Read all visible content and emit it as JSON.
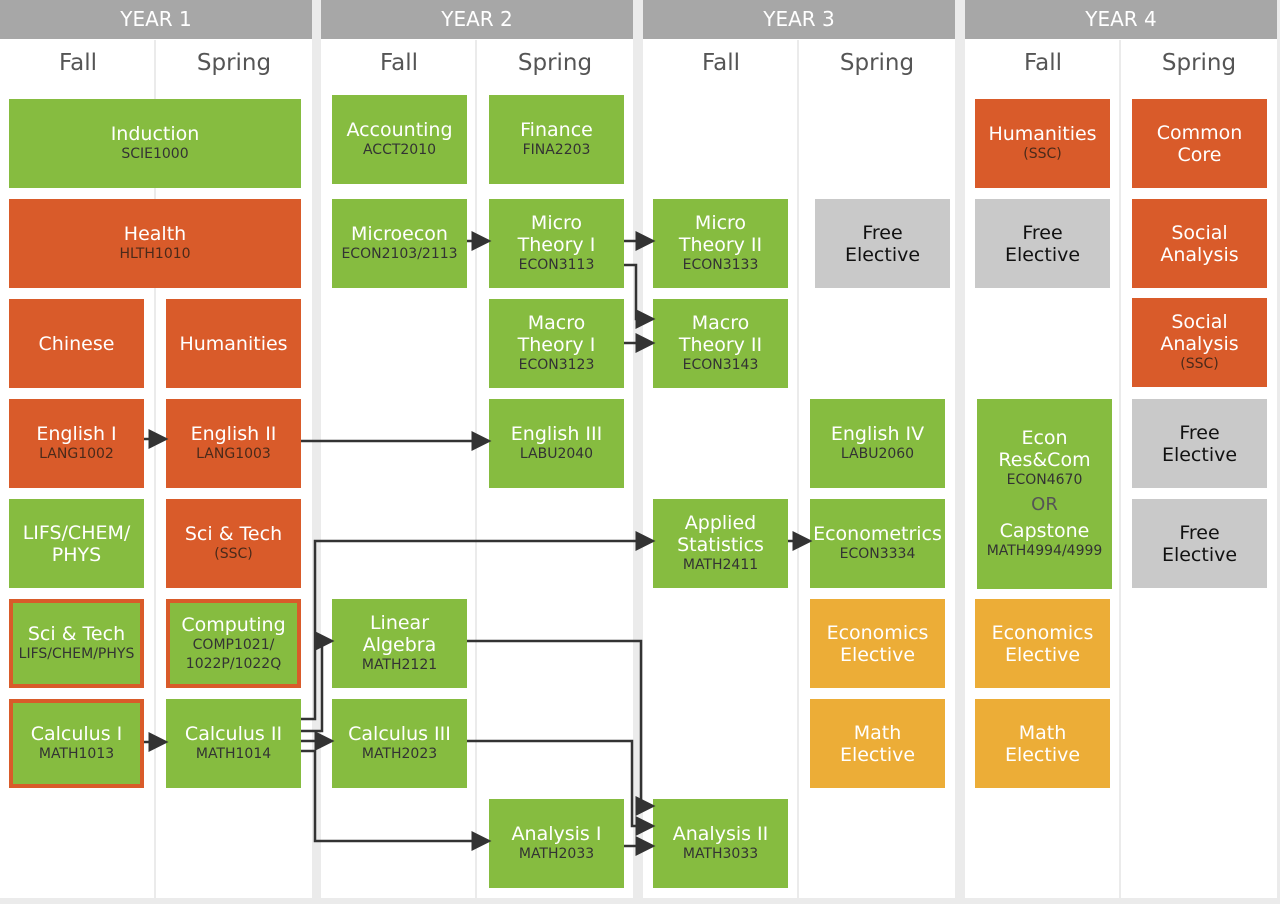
{
  "colors": {
    "green": "#86bc40",
    "orange": "#d95b2a",
    "gray": "#c9c9c9",
    "yellow": "#ecad37",
    "header": "#a7a7a7",
    "arrow": "#333333"
  },
  "years": [
    {
      "label": "YEAR 1",
      "fall": "Fall",
      "spring": "Spring"
    },
    {
      "label": "YEAR 2",
      "fall": "Fall",
      "spring": "Spring"
    },
    {
      "label": "YEAR 3",
      "fall": "Fall",
      "spring": "Spring"
    },
    {
      "label": "YEAR 4",
      "fall": "Fall",
      "spring": "Spring"
    }
  ],
  "boxes": [
    {
      "title": "Induction",
      "code": "SCIE1000",
      "color": "green"
    },
    {
      "title": "Health",
      "code": "HLTH1010",
      "color": "orange"
    },
    {
      "title": "Chinese",
      "code": "",
      "color": "orange"
    },
    {
      "title": "Humanities",
      "code": "",
      "color": "orange"
    },
    {
      "title": "English I",
      "code": "LANG1002",
      "color": "orange"
    },
    {
      "title": "English II",
      "code": "LANG1003",
      "color": "orange"
    },
    {
      "title": "LIFS/CHEM/\nPHYS",
      "code": "",
      "color": "green"
    },
    {
      "title": "Sci & Tech",
      "code": "(SSC)",
      "color": "orange"
    },
    {
      "title": "Sci & Tech",
      "code": "LIFS/CHEM/PHYS",
      "color": "green",
      "bordered": true
    },
    {
      "title": "Computing",
      "code": "COMP1021/\n1022P/1022Q",
      "color": "green",
      "bordered": true
    },
    {
      "title": "Calculus I",
      "code": "MATH1013",
      "color": "green",
      "bordered": true
    },
    {
      "title": "Calculus II",
      "code": "MATH1014",
      "color": "green"
    },
    {
      "title": "Accounting",
      "code": "ACCT2010",
      "color": "green"
    },
    {
      "title": "Finance",
      "code": "FINA2203",
      "color": "green"
    },
    {
      "title": "Microecon",
      "code": "ECON2103/2113",
      "color": "green"
    },
    {
      "title": "Micro\nTheory I",
      "code": "ECON3113",
      "color": "green"
    },
    {
      "title": "Macro\nTheory I",
      "code": "ECON3123",
      "color": "green"
    },
    {
      "title": "English III",
      "code": "LABU2040",
      "color": "green"
    },
    {
      "title": "Linear\nAlgebra",
      "code": "MATH2121",
      "color": "green"
    },
    {
      "title": "Calculus III",
      "code": "MATH2023",
      "color": "green"
    },
    {
      "title": "Analysis I",
      "code": "MATH2033",
      "color": "green"
    },
    {
      "title": "Micro\nTheory II",
      "code": "ECON3133",
      "color": "green"
    },
    {
      "title": "Free\nElective",
      "code": "",
      "color": "gray"
    },
    {
      "title": "Macro\nTheory II",
      "code": "ECON3143",
      "color": "green"
    },
    {
      "title": "English IV",
      "code": "LABU2060",
      "color": "green"
    },
    {
      "title": "Applied\nStatistics",
      "code": "MATH2411",
      "color": "green"
    },
    {
      "title": "Econometrics",
      "code": "ECON3334",
      "color": "green"
    },
    {
      "title": "Economics\nElective",
      "code": "",
      "color": "yellow"
    },
    {
      "title": "Math\nElective",
      "code": "",
      "color": "yellow"
    },
    {
      "title": "Analysis II",
      "code": "MATH3033",
      "color": "green"
    },
    {
      "title": "Humanities",
      "code": "(SSC)",
      "color": "orange"
    },
    {
      "title": "Common\nCore",
      "code": "",
      "color": "orange"
    },
    {
      "title": "Free\nElective",
      "code": "",
      "color": "gray"
    },
    {
      "title": "Social\nAnalysis",
      "code": "",
      "color": "orange"
    },
    {
      "title": "Social\nAnalysis",
      "code": "(SSC)",
      "color": "orange"
    },
    {
      "title": "Econ\nRes&Com",
      "code": "ECON4670",
      "or": "OR",
      "title2": "Capstone",
      "code2": "MATH4994/4999",
      "color": "green"
    },
    {
      "title": "Free\nElective",
      "code": "",
      "color": "gray"
    },
    {
      "title": "Free\nElective",
      "code": "",
      "color": "gray"
    },
    {
      "title": "Economics\nElective",
      "code": "",
      "color": "yellow"
    },
    {
      "title": "Math\nElective",
      "code": "",
      "color": "yellow"
    }
  ]
}
